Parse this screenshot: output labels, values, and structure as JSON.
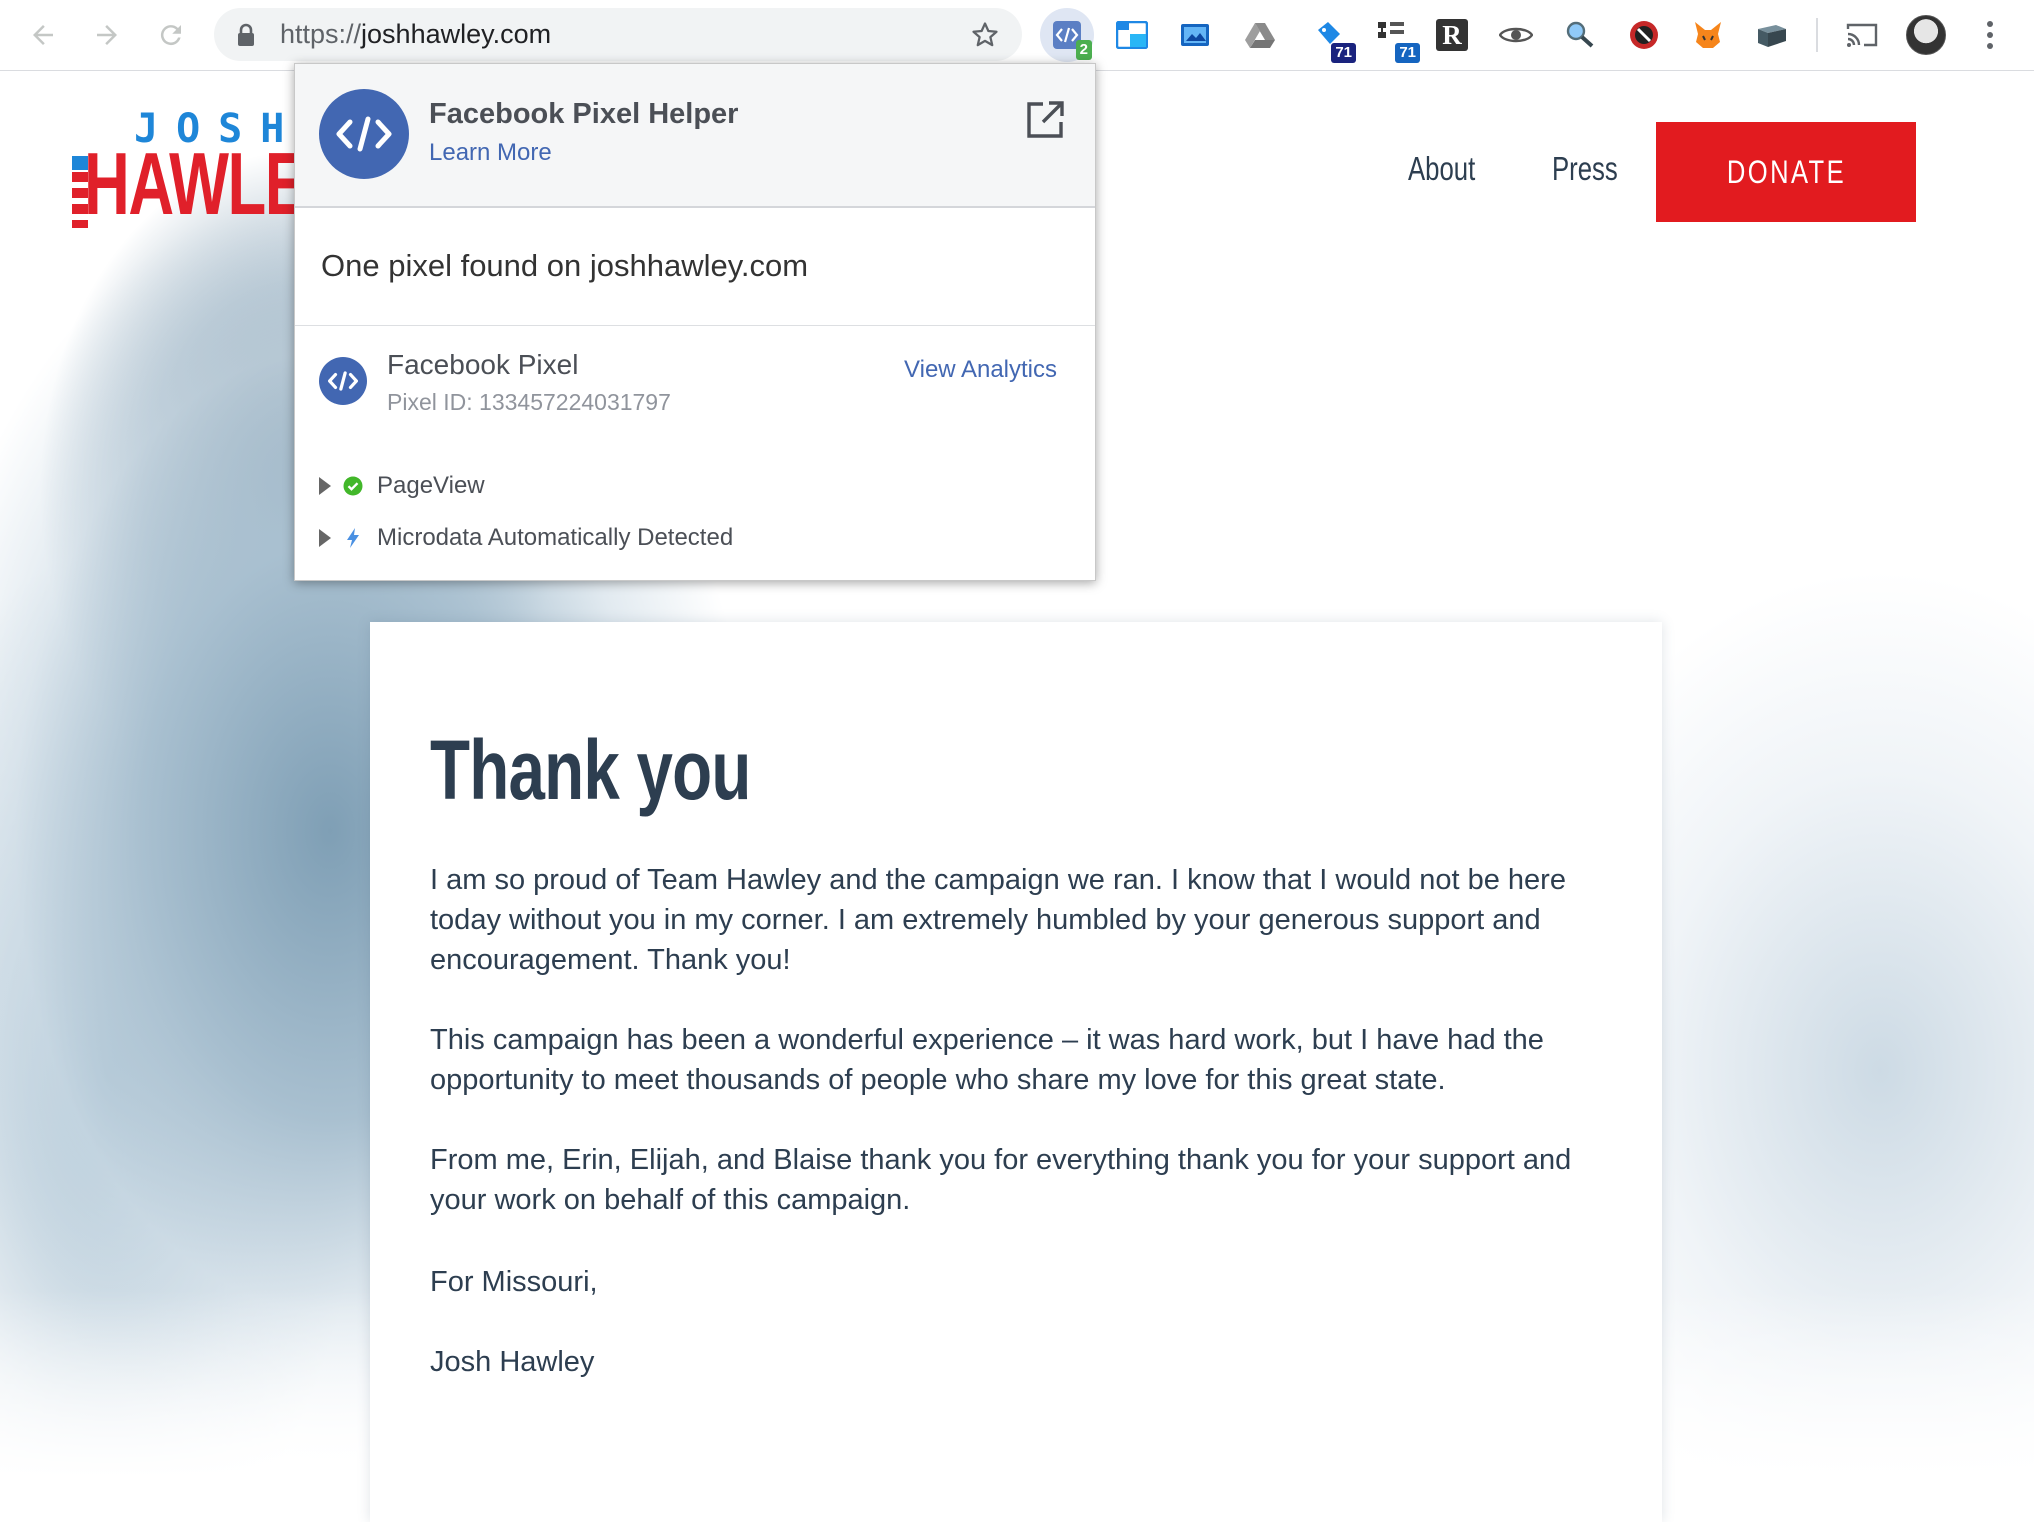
{
  "browser": {
    "url_scheme": "https://",
    "url_host": "joshhawley.com",
    "extensions": [
      {
        "name": "facebook-pixel-helper",
        "badge": "2",
        "badge_color": "#4caf50"
      },
      {
        "name": "window-tab",
        "badge": ""
      },
      {
        "name": "screenshot",
        "badge": ""
      },
      {
        "name": "google-drive",
        "badge": ""
      },
      {
        "name": "tag-assistant",
        "badge": "71",
        "badge_color": "#1a237e"
      },
      {
        "name": "network-tree",
        "badge": "71",
        "badge_color": "#1565c0"
      },
      {
        "name": "readability",
        "label": "R"
      },
      {
        "name": "eye",
        "badge": ""
      },
      {
        "name": "magnifier-person",
        "badge": ""
      },
      {
        "name": "blocker",
        "badge": ""
      },
      {
        "name": "metamask-fox",
        "badge": ""
      },
      {
        "name": "folder",
        "badge": ""
      },
      {
        "name": "cast",
        "badge": ""
      },
      {
        "name": "profile-avatar",
        "badge": ""
      }
    ]
  },
  "site": {
    "logo_top": "JOSH",
    "logo_main": "HAWLEY",
    "nav": [
      "About",
      "Press"
    ],
    "donate_label": "DONATE",
    "colors": {
      "brand_red": "#e21b1f",
      "brand_blue": "#1e86d8",
      "text_dark": "#2d3e50"
    }
  },
  "letter": {
    "title": "Thank you",
    "paragraphs": [
      "I am so proud of Team Hawley and the campaign we ran. I know that I would not be here today without you in my corner. I am extremely humbled by your generous support and encouragement. Thank you!",
      "This campaign has been a wonderful experience – it was hard work, but I have had the opportunity to meet thousands of people who share my love for this great state.",
      "From me, Erin, Elijah, and Blaise thank you for everything thank you for your support and your work on behalf of this campaign.",
      "For Missouri,",
      "Josh Hawley"
    ]
  },
  "pixel_helper": {
    "title": "Facebook Pixel Helper",
    "learn_more": "Learn More",
    "summary": "One pixel found on joshhawley.com",
    "pixel_name": "Facebook Pixel",
    "pixel_id_label": "Pixel ID: 133457224031797",
    "view_analytics": "View Analytics",
    "events": [
      {
        "label": "PageView",
        "status": "success"
      },
      {
        "label": "Microdata Automatically Detected",
        "status": "info"
      }
    ],
    "colors": {
      "fb_blue": "#4267b2",
      "success": "#42b72a"
    }
  }
}
